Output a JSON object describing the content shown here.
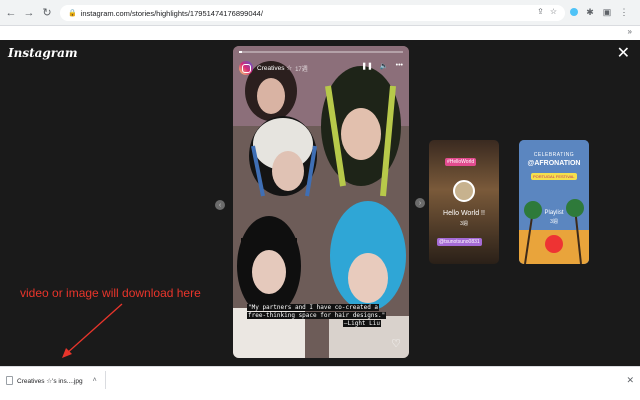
{
  "browser": {
    "url": "instagram.com/stories/highlights/17951474176899044/"
  },
  "app": {
    "logo": "Instagram"
  },
  "story": {
    "username": "Creatives ☆",
    "time": "17週",
    "caption_lines": [
      "\"My partners and I have co-created a",
      "free-thinking space for hair designs.\"",
      "—Light Liu"
    ],
    "progress": 0.02
  },
  "thumbnails": [
    {
      "tag": "#HelloWorld",
      "title": "Hello World !!",
      "subtitle": "3週",
      "handle": "@tsunotsuno0831"
    },
    {
      "top": "CELEBRATING",
      "brand": "@AFRONATION",
      "sub": "PORTUGAL FESTIVAL",
      "playlist": "Playlist",
      "subtitle": "3週"
    }
  ],
  "annotation": "video or image will download here",
  "download": {
    "filename": "Creatives ☆'s ins....jpg"
  },
  "colors": {
    "annotation": "#e8352b",
    "viewer_bg": "#1a1a1a"
  }
}
